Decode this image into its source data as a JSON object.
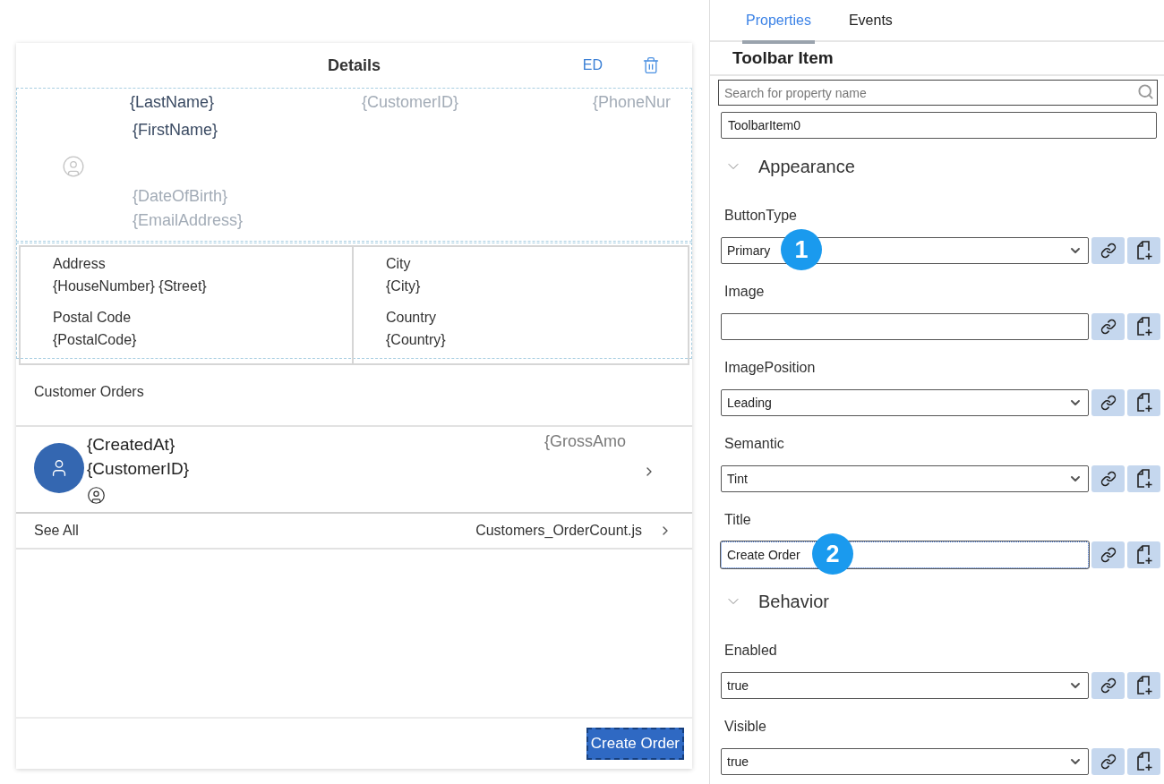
{
  "editor": {
    "header": {
      "title": "Details",
      "action": "ED"
    },
    "profile": {
      "last_name": "{LastName}",
      "customer_id": "{CustomerID}",
      "phone": "{PhoneNur",
      "first_name": "{FirstName}",
      "date_of_birth": "{DateOfBirth}",
      "email": "{EmailAddress}"
    },
    "address_cells": [
      {
        "label": "Address",
        "value": "{HouseNumber} {Street}"
      },
      {
        "label": "City",
        "value": "{City}"
      },
      {
        "label": "Postal Code",
        "value": "{PostalCode}"
      },
      {
        "label": "Country",
        "value": "{Country}"
      }
    ],
    "section_title": "Customer Orders",
    "order": {
      "title": "{CreatedAt}",
      "subtitle": "{CustomerID}",
      "amount": "{GrossAmo"
    },
    "see_all": {
      "label": "See All",
      "target": "Customers_OrderCount.js"
    },
    "toolbar_button": "Create Order"
  },
  "properties_panel": {
    "tabs": [
      {
        "label": "Properties",
        "selected": true
      },
      {
        "label": "Events",
        "selected": false
      }
    ],
    "heading": "Toolbar Item",
    "search": {
      "placeholder": "Search for property name"
    },
    "name_value": "ToolbarItem0",
    "groups": [
      {
        "title": "Appearance",
        "expanded": true,
        "properties": [
          {
            "label": "ButtonType",
            "kind": "select",
            "value": "Primary",
            "focused": false,
            "callout": "1"
          },
          {
            "label": "Image",
            "kind": "text",
            "focused": false
          },
          {
            "label": "ImagePosition",
            "kind": "select",
            "value": "Leading",
            "focused": false
          },
          {
            "label": "Semantic",
            "kind": "select",
            "value": "Tint",
            "focused": false
          },
          {
            "label": "Title",
            "kind": "text",
            "value": "Create Order",
            "focused": true,
            "callout": "2"
          }
        ]
      },
      {
        "title": "Behavior",
        "expanded": true,
        "properties": [
          {
            "label": "Enabled",
            "kind": "select",
            "value": "true",
            "focused": false
          },
          {
            "label": "Visible",
            "kind": "select",
            "value": "true",
            "focused": false
          }
        ]
      }
    ]
  }
}
